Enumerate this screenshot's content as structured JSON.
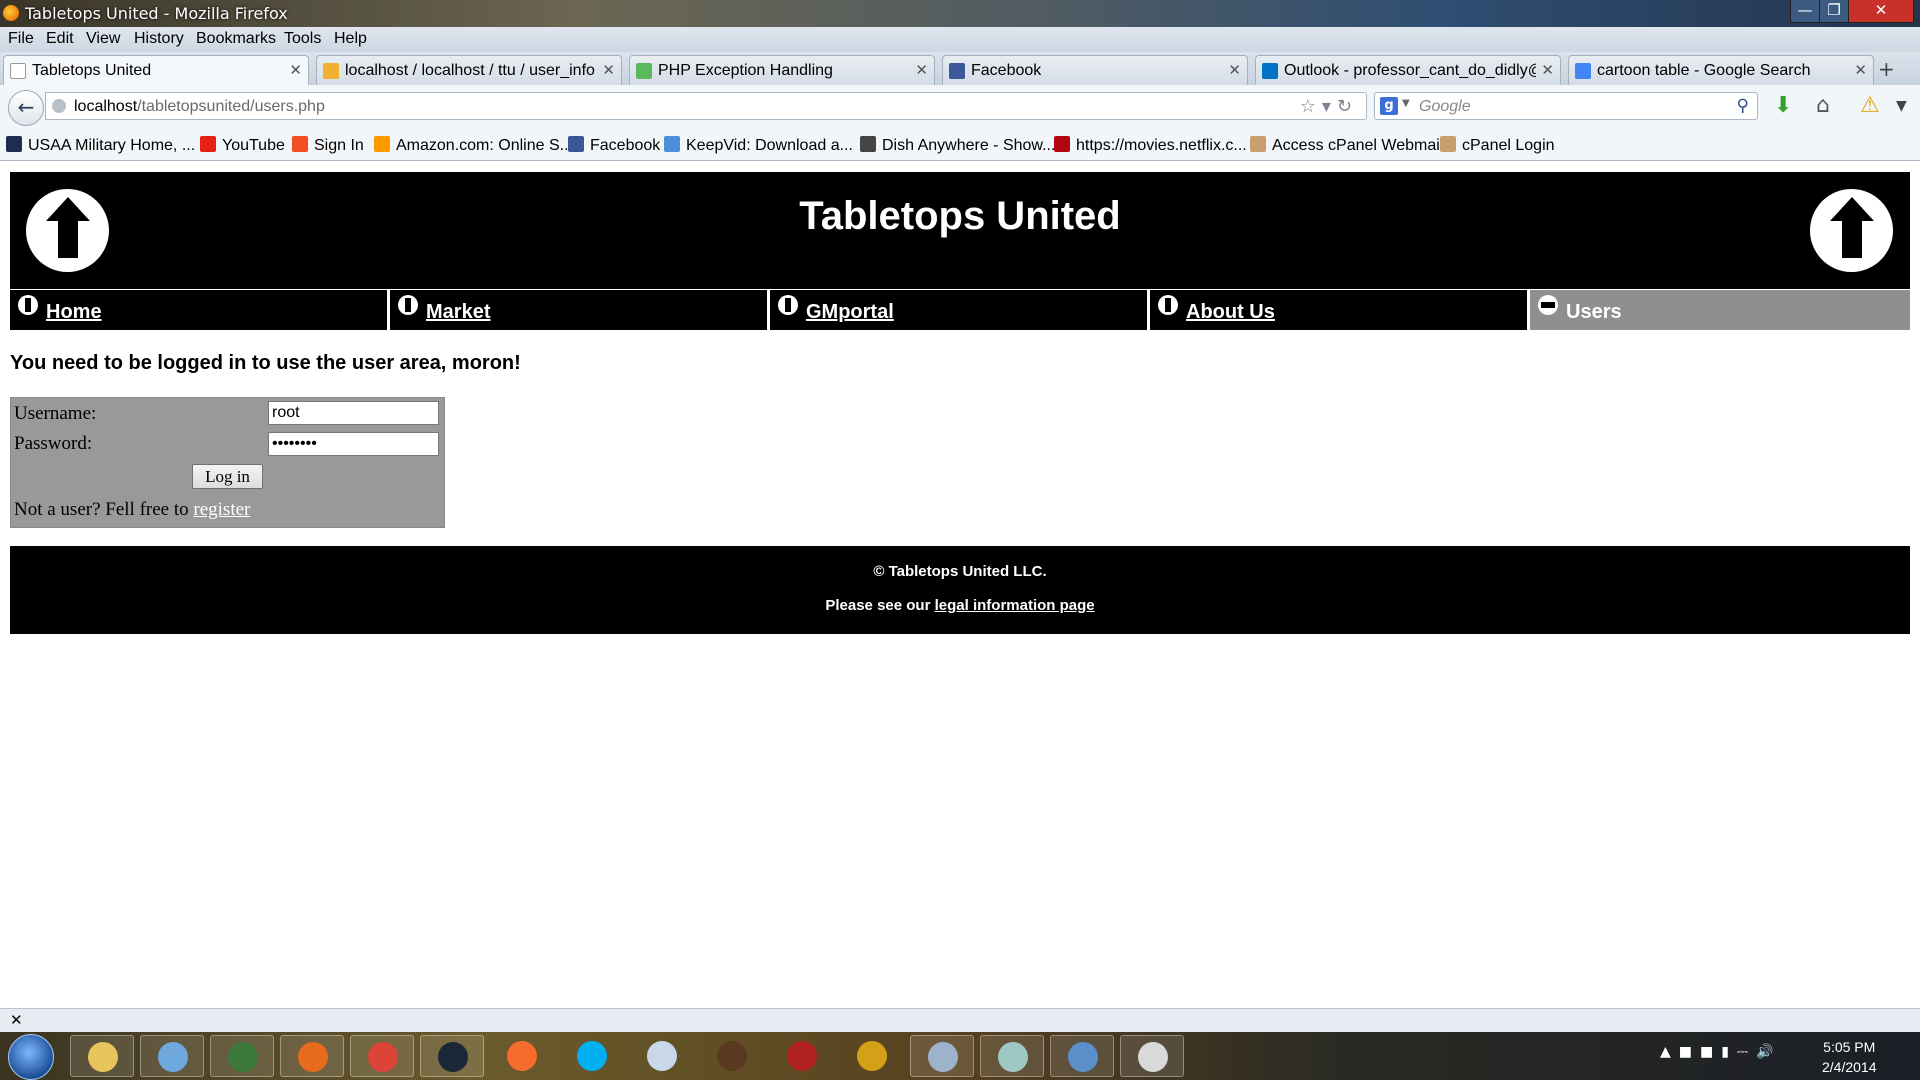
{
  "window": {
    "title": "Tabletops United - Mozilla Firefox"
  },
  "menu": [
    "File",
    "Edit",
    "View",
    "History",
    "Bookmarks",
    "Tools",
    "Help"
  ],
  "tabs": [
    {
      "label": "Tabletops United",
      "favicon": "blank-page-icon",
      "color": "#ffffff"
    },
    {
      "label": "localhost / localhost / ttu / user_info |...",
      "favicon": "phpmyadmin-icon",
      "color": "#f0b030"
    },
    {
      "label": "PHP Exception Handling",
      "favicon": "w3schools-icon",
      "color": "#5cb85c"
    },
    {
      "label": "Facebook",
      "favicon": "facebook-icon",
      "color": "#3b5998"
    },
    {
      "label": "Outlook - professor_cant_do_didly@h...",
      "favicon": "outlook-icon",
      "color": "#0072c6"
    },
    {
      "label": "cartoon table - Google Search",
      "favicon": "google-icon",
      "color": "#4285f4"
    }
  ],
  "address": {
    "host": "localhost",
    "path": "/tabletopsunited/users.php"
  },
  "search": {
    "placeholder": "Google"
  },
  "bookmarks": [
    {
      "label": "USAA Military Home, ...",
      "icon": "usaa-icon",
      "color": "#1d2d50"
    },
    {
      "label": "YouTube",
      "icon": "youtube-icon",
      "color": "#e62117"
    },
    {
      "label": "Sign In",
      "icon": "windows-icon",
      "color": "#f25022"
    },
    {
      "label": "Amazon.com: Online S...",
      "icon": "amazon-icon",
      "color": "#ff9900"
    },
    {
      "label": "Facebook",
      "icon": "facebook-icon",
      "color": "#3b5998"
    },
    {
      "label": "KeepVid: Download a...",
      "icon": "keepvid-icon",
      "color": "#4a90d9"
    },
    {
      "label": "Dish Anywhere - Show...",
      "icon": "dish-icon",
      "color": "#444444"
    },
    {
      "label": "https://movies.netflix.c...",
      "icon": "netflix-icon",
      "color": "#b20710"
    },
    {
      "label": "Access cPanel Webmail",
      "icon": "cpanel-icon",
      "color": "#c8a070"
    },
    {
      "label": "cPanel Login",
      "icon": "cpanel-icon",
      "color": "#c8a070"
    }
  ],
  "site": {
    "title": "Tabletops United",
    "nav": [
      {
        "label": "Home",
        "current": false
      },
      {
        "label": "Market",
        "current": false
      },
      {
        "label": "GMportal",
        "current": false
      },
      {
        "label": "About Us",
        "current": false
      },
      {
        "label": "Users",
        "current": true
      }
    ],
    "notice": "You need to be logged in to use the user area, moron!",
    "login": {
      "username_label": "Username:",
      "username_value": "root",
      "password_label": "Password:",
      "password_value": "password",
      "button": "Log in",
      "register_prompt": "Not a user? Fell free to",
      "register_link": "register"
    },
    "footer": {
      "copyright": "© Tabletops United LLC.",
      "legal_prefix": "Please see our",
      "legal_link": "legal information page"
    }
  },
  "taskbar": {
    "apps": [
      {
        "name": "file-explorer-icon",
        "color": "#e8c45a",
        "pinned": true
      },
      {
        "name": "notepad-icon",
        "color": "#6fa8dc",
        "pinned": true
      },
      {
        "name": "monitor-app-icon",
        "color": "#3c7a3c",
        "pinned": true
      },
      {
        "name": "firefox-icon",
        "color": "#e76b1c",
        "pinned": true
      },
      {
        "name": "chrome-icon",
        "color": "#db4437",
        "pinned": true
      },
      {
        "name": "steam-icon",
        "color": "#1b2838",
        "pinned": true
      },
      {
        "name": "origin-icon",
        "color": "#f56c2d",
        "pinned": false
      },
      {
        "name": "skype-icon",
        "color": "#00aff0",
        "pinned": false
      },
      {
        "name": "pidgin-icon",
        "color": "#c8d8e8",
        "pinned": false
      },
      {
        "name": "horse-game-icon",
        "color": "#5a3a20",
        "pinned": false
      },
      {
        "name": "thirteen-app-icon",
        "color": "#b22222",
        "pinned": false
      },
      {
        "name": "fs-app-icon",
        "color": "#d4a017",
        "pinned": false
      },
      {
        "name": "calculator-icon",
        "color": "#9db3cc",
        "pinned": true
      },
      {
        "name": "notes-icon",
        "color": "#9fc7c3",
        "pinned": true
      },
      {
        "name": "photo-viewer-icon",
        "color": "#5b8fc9",
        "pinned": true
      },
      {
        "name": "paint-icon",
        "color": "#d9d9d9",
        "pinned": true
      }
    ],
    "time": "5:05 PM",
    "date": "2/4/2014"
  }
}
